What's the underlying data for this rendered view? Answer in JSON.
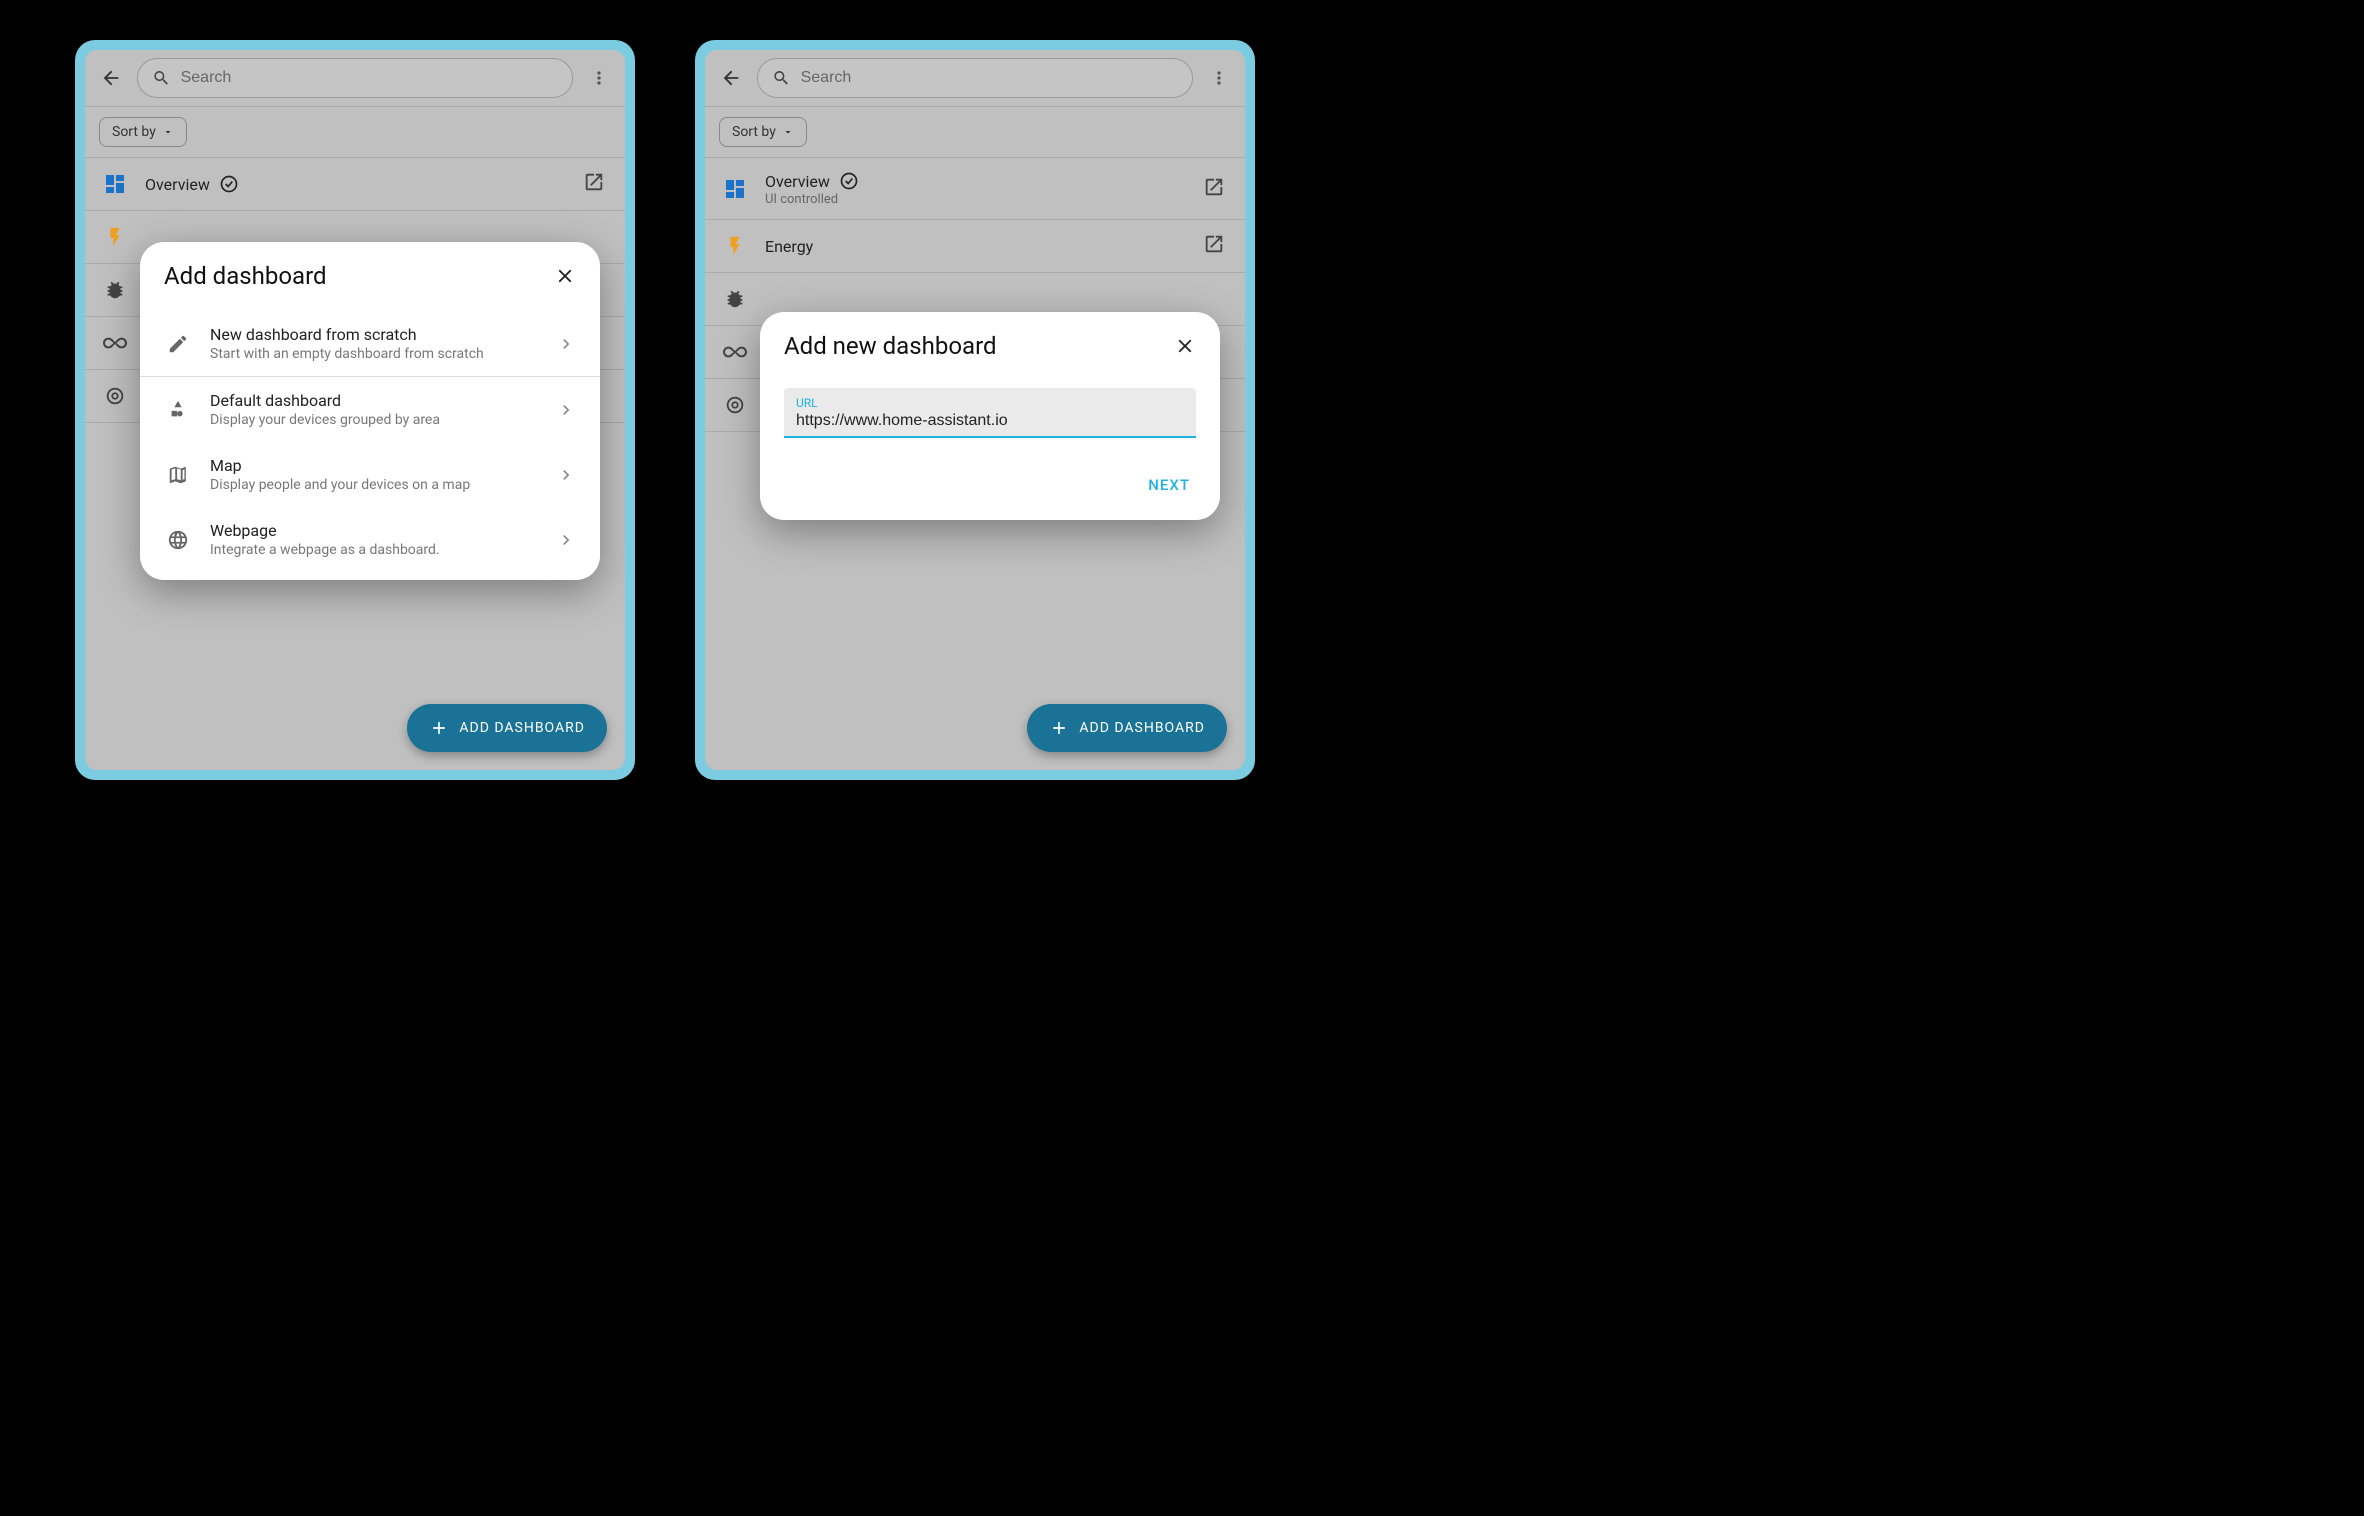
{
  "common": {
    "search_placeholder": "Search",
    "sort_label": "Sort by",
    "fab_label": "ADD DASHBOARD"
  },
  "screen_left": {
    "list": [
      {
        "title": "Overview",
        "sub": "",
        "checked": true
      }
    ],
    "dialog": {
      "title": "Add dashboard",
      "options": [
        {
          "title": "New dashboard from scratch",
          "sub": "Start with an empty dashboard from scratch"
        },
        {
          "title": "Default dashboard",
          "sub": "Display your devices grouped by area"
        },
        {
          "title": "Map",
          "sub": "Display people and your devices on a map"
        },
        {
          "title": "Webpage",
          "sub": "Integrate a webpage as a dashboard."
        }
      ]
    }
  },
  "screen_right": {
    "list": [
      {
        "title": "Overview",
        "sub": "UI controlled",
        "checked": true
      },
      {
        "title": "Energy",
        "sub": ""
      }
    ],
    "dialog": {
      "title": "Add new dashboard",
      "url_label": "URL",
      "url_value": "https://www.home-assistant.io",
      "next_label": "NEXT"
    }
  }
}
